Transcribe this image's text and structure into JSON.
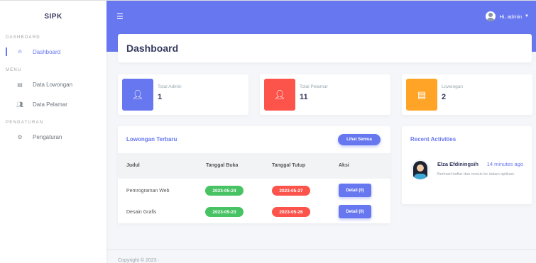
{
  "brand": "SIPK",
  "sidebar": {
    "sections": [
      {
        "header": "DASHBOARD",
        "items": [
          {
            "label": "Dashboard",
            "icon": "fire-icon"
          }
        ]
      },
      {
        "header": "MENU",
        "items": [
          {
            "label": "Data Lowongan",
            "icon": "card-icon"
          },
          {
            "label": "Data Pelamar",
            "icon": "users-icon"
          }
        ]
      },
      {
        "header": "PENGATURAN",
        "items": [
          {
            "label": "Pengaturan",
            "icon": "gears-icon"
          }
        ]
      }
    ]
  },
  "topbar": {
    "user_label": "Hi, admin"
  },
  "page": {
    "title": "Dashboard"
  },
  "stats": [
    {
      "label": "Total Admin",
      "value": "1",
      "color": "#6777ef",
      "icon": "admin-icon"
    },
    {
      "label": "Total Pelamar",
      "value": "11",
      "color": "#fc544b",
      "icon": "user-icon"
    },
    {
      "label": "Lowongan",
      "value": "2",
      "color": "#ffa426",
      "icon": "card-icon"
    }
  ],
  "lowongan": {
    "title": "Lowongan Terbaru",
    "button": "Lihat Semua",
    "columns": [
      "Judul",
      "Tanggal Buka",
      "Tanggal Tutup",
      "Aksi"
    ],
    "rows": [
      {
        "judul": "Pemrograman Web",
        "buka": "2023-05-24",
        "tutup": "2023-05-27",
        "aksi": "Detail (0)"
      },
      {
        "judul": "Desain Grafis",
        "buka": "2023-05-23",
        "tutup": "2023-05-26",
        "aksi": "Detail (0)"
      }
    ]
  },
  "activities": {
    "title": "Recent Activities",
    "items": [
      {
        "name": "Elza Efdiningsih",
        "time": "14 minutes ago",
        "desc": "Berhasil daftar dan masuk ke dalam aplikasi."
      }
    ]
  },
  "footer": {
    "text": "Copyright © 2023 ·"
  },
  "colors": {
    "primary": "#6777ef",
    "success": "#47c363",
    "danger": "#fc544b",
    "warning": "#ffa426"
  }
}
